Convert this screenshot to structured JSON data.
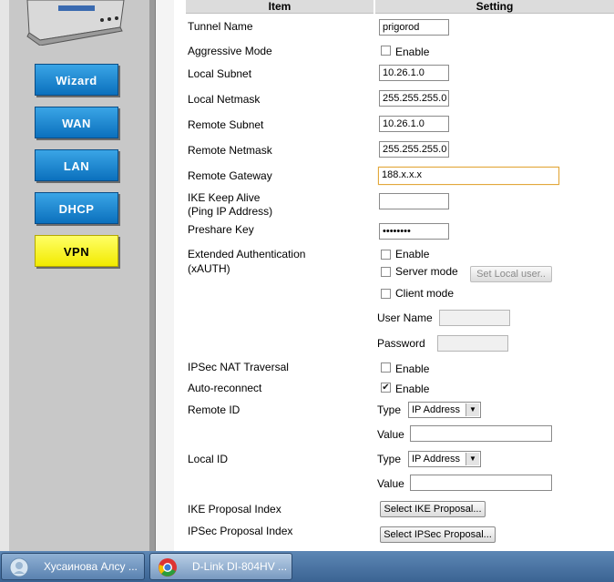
{
  "nav": {
    "items": [
      {
        "label": "Wizard"
      },
      {
        "label": "WAN"
      },
      {
        "label": "LAN"
      },
      {
        "label": "DHCP"
      },
      {
        "label": "VPN",
        "active": true
      }
    ],
    "button_color": "#1a86d2",
    "active_color": "#ffff33"
  },
  "table": {
    "col_item": "Item",
    "col_setting": "Setting"
  },
  "form": {
    "tunnel_name": {
      "label": "Tunnel Name",
      "value": "prigorod"
    },
    "aggressive_mode": {
      "label": "Aggressive Mode",
      "enable": "Enable",
      "checked": false
    },
    "local_subnet": {
      "label": "Local Subnet",
      "value": "10.26.1.0"
    },
    "local_netmask": {
      "label": "Local Netmask",
      "value": "255.255.255.0"
    },
    "remote_subnet": {
      "label": "Remote Subnet",
      "value": "10.26.1.0"
    },
    "remote_netmask": {
      "label": "Remote Netmask",
      "value": "255.255.255.0"
    },
    "remote_gateway": {
      "label": "Remote Gateway",
      "value": "188.x.x.x"
    },
    "ike_keep_alive": {
      "label_1": "IKE Keep Alive",
      "label_2": "(Ping IP Address)",
      "value": ""
    },
    "preshare_key": {
      "label": "Preshare Key",
      "value": "••••••••"
    },
    "xauth": {
      "label_1": "Extended Authentication",
      "label_2": "(xAUTH)",
      "enable": "Enable",
      "server_mode": "Server mode",
      "client_mode": "Client mode",
      "set_local_user": "Set Local user..",
      "user_name": "User Name",
      "password": "Password"
    },
    "nat_traversal": {
      "label": "IPSec NAT Traversal",
      "enable": "Enable",
      "checked": false
    },
    "auto_reconnect": {
      "label": "Auto-reconnect",
      "enable": "Enable",
      "checked": true
    },
    "remote_id": {
      "label": "Remote ID",
      "type_label": "Type",
      "type_value": "IP Address",
      "value_label": "Value",
      "value": ""
    },
    "local_id": {
      "label": "Local ID",
      "type_label": "Type",
      "type_value": "IP Address",
      "value_label": "Value",
      "value": ""
    },
    "ike_proposal": {
      "label": "IKE Proposal Index",
      "button": "Select IKE Proposal..."
    },
    "ipsec_proposal": {
      "label": "IPSec Proposal Index",
      "button": "Select IPSec Proposal..."
    }
  },
  "taskbar": {
    "items": [
      {
        "label": "Хусаинова Алсу ...",
        "icon": "messenger-icon"
      },
      {
        "label": "D-Link DI-804HV ...",
        "icon": "chrome-icon"
      }
    ]
  }
}
